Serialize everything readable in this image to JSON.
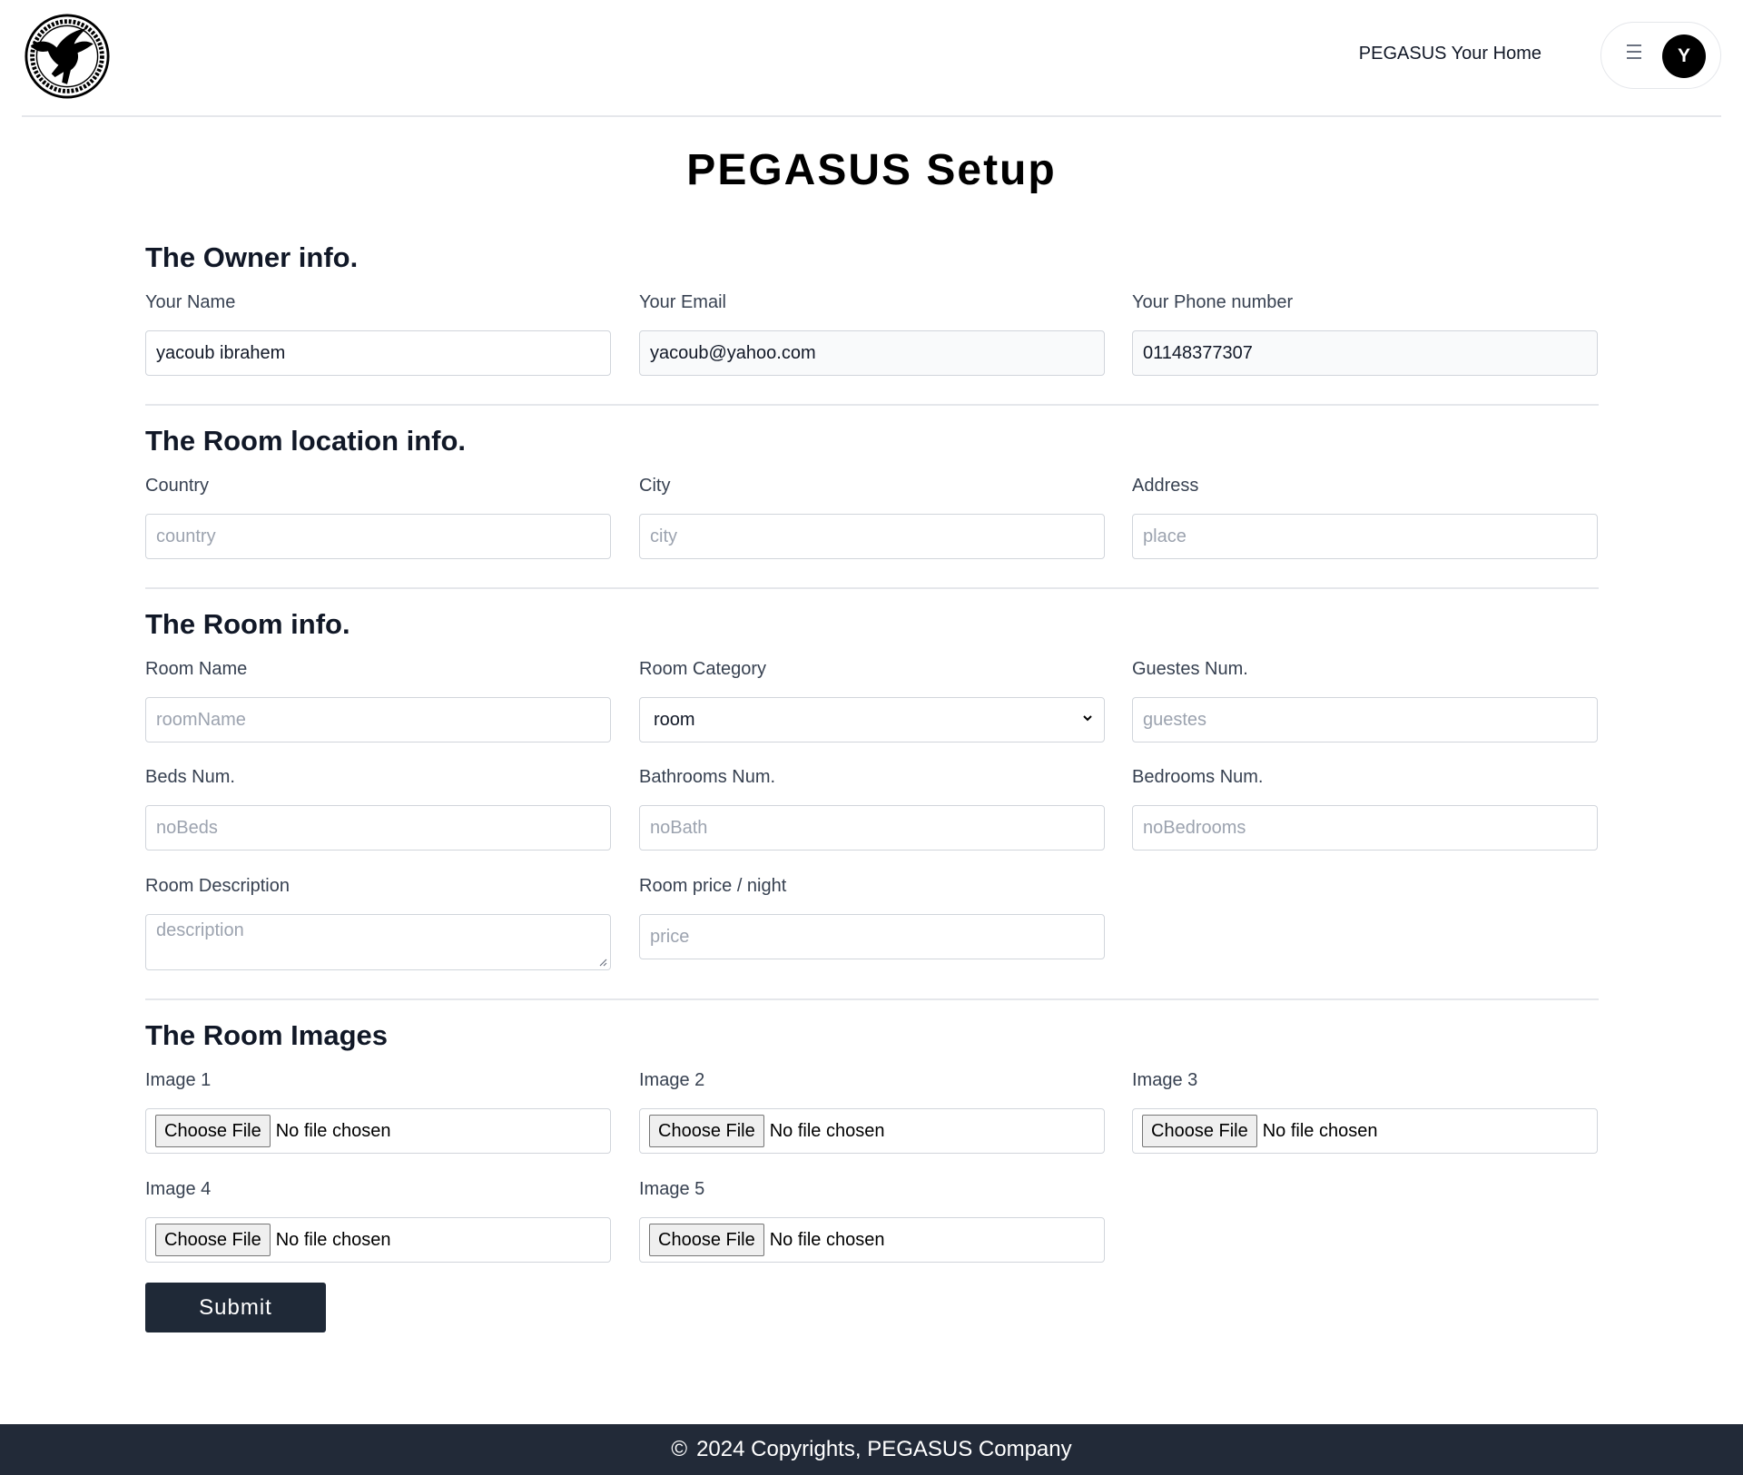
{
  "header": {
    "nav_link": "PEGASUS Your Home",
    "avatar_initial": "Y"
  },
  "page_title": "PEGASUS Setup",
  "owner": {
    "title": "The Owner info.",
    "name": {
      "label": "Your Name",
      "value": "yacoub ibrahem"
    },
    "email": {
      "label": "Your Email",
      "value": "yacoub@yahoo.com"
    },
    "phone": {
      "label": "Your Phone number",
      "value": "01148377307"
    }
  },
  "location": {
    "title": "The Room location info.",
    "country": {
      "label": "Country",
      "placeholder": "country"
    },
    "city": {
      "label": "City",
      "placeholder": "city"
    },
    "address": {
      "label": "Address",
      "placeholder": "place"
    }
  },
  "room": {
    "title": "The Room info.",
    "name": {
      "label": "Room Name",
      "placeholder": "roomName"
    },
    "category": {
      "label": "Room Category",
      "value": "room"
    },
    "guests": {
      "label": "Guestes Num.",
      "placeholder": "guestes"
    },
    "beds": {
      "label": "Beds Num.",
      "placeholder": "noBeds"
    },
    "bathrooms": {
      "label": "Bathrooms Num.",
      "placeholder": "noBath"
    },
    "bedrooms": {
      "label": "Bedrooms Num.",
      "placeholder": "noBedrooms"
    },
    "description": {
      "label": "Room Description",
      "placeholder": "description"
    },
    "price": {
      "label": "Room price / night",
      "placeholder": "price"
    }
  },
  "images": {
    "title": "The Room Images",
    "choose_label": "Choose File",
    "no_file": "No file chosen",
    "items": [
      {
        "label": "Image 1"
      },
      {
        "label": "Image 2"
      },
      {
        "label": "Image 3"
      },
      {
        "label": "Image 4"
      },
      {
        "label": "Image 5"
      }
    ]
  },
  "submit_label": "Submit",
  "footer": {
    "copyright_symbol": "©",
    "text": "2024 Copyrights, PEGASUS Company"
  },
  "icons": {
    "logo": "pegasus-logo",
    "menu": "hamburger-icon",
    "select": "chevron-down-icon",
    "copyright": "copyright-icon"
  }
}
